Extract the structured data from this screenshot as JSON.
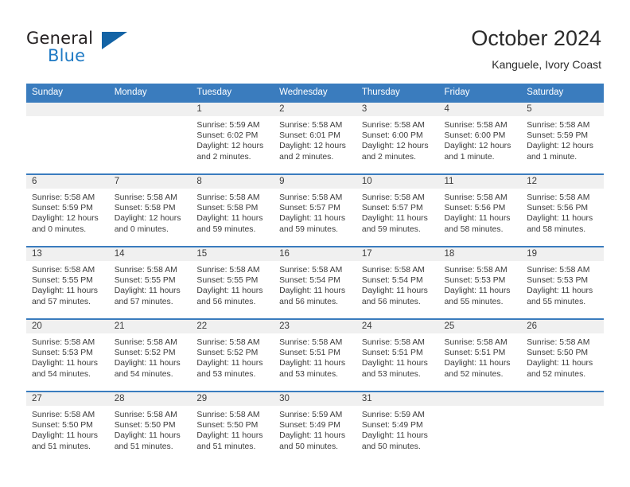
{
  "brand": {
    "name_part1": "General",
    "name_part2": "Blue",
    "accent_color": "#1f7ac4",
    "triangle_color": "#1363a5"
  },
  "header": {
    "title": "October 2024",
    "subtitle": "Kanguele, Ivory Coast"
  },
  "calendar": {
    "header_bg": "#3a7cbe",
    "daynum_bg": "#f0f0f0",
    "weekday_labels": [
      "Sunday",
      "Monday",
      "Tuesday",
      "Wednesday",
      "Thursday",
      "Friday",
      "Saturday"
    ],
    "labels": {
      "sunrise_prefix": "Sunrise:",
      "sunset_prefix": "Sunset:",
      "daylight_prefix": "Daylight:"
    },
    "weeks": [
      [
        {
          "day": "",
          "sunrise": "",
          "sunset": "",
          "daylight_line1": "",
          "daylight_line2": ""
        },
        {
          "day": "",
          "sunrise": "",
          "sunset": "",
          "daylight_line1": "",
          "daylight_line2": ""
        },
        {
          "day": "1",
          "sunrise": "Sunrise: 5:59 AM",
          "sunset": "Sunset: 6:02 PM",
          "daylight_line1": "Daylight: 12 hours",
          "daylight_line2": "and 2 minutes."
        },
        {
          "day": "2",
          "sunrise": "Sunrise: 5:58 AM",
          "sunset": "Sunset: 6:01 PM",
          "daylight_line1": "Daylight: 12 hours",
          "daylight_line2": "and 2 minutes."
        },
        {
          "day": "3",
          "sunrise": "Sunrise: 5:58 AM",
          "sunset": "Sunset: 6:00 PM",
          "daylight_line1": "Daylight: 12 hours",
          "daylight_line2": "and 2 minutes."
        },
        {
          "day": "4",
          "sunrise": "Sunrise: 5:58 AM",
          "sunset": "Sunset: 6:00 PM",
          "daylight_line1": "Daylight: 12 hours",
          "daylight_line2": "and 1 minute."
        },
        {
          "day": "5",
          "sunrise": "Sunrise: 5:58 AM",
          "sunset": "Sunset: 5:59 PM",
          "daylight_line1": "Daylight: 12 hours",
          "daylight_line2": "and 1 minute."
        }
      ],
      [
        {
          "day": "6",
          "sunrise": "Sunrise: 5:58 AM",
          "sunset": "Sunset: 5:59 PM",
          "daylight_line1": "Daylight: 12 hours",
          "daylight_line2": "and 0 minutes."
        },
        {
          "day": "7",
          "sunrise": "Sunrise: 5:58 AM",
          "sunset": "Sunset: 5:58 PM",
          "daylight_line1": "Daylight: 12 hours",
          "daylight_line2": "and 0 minutes."
        },
        {
          "day": "8",
          "sunrise": "Sunrise: 5:58 AM",
          "sunset": "Sunset: 5:58 PM",
          "daylight_line1": "Daylight: 11 hours",
          "daylight_line2": "and 59 minutes."
        },
        {
          "day": "9",
          "sunrise": "Sunrise: 5:58 AM",
          "sunset": "Sunset: 5:57 PM",
          "daylight_line1": "Daylight: 11 hours",
          "daylight_line2": "and 59 minutes."
        },
        {
          "day": "10",
          "sunrise": "Sunrise: 5:58 AM",
          "sunset": "Sunset: 5:57 PM",
          "daylight_line1": "Daylight: 11 hours",
          "daylight_line2": "and 59 minutes."
        },
        {
          "day": "11",
          "sunrise": "Sunrise: 5:58 AM",
          "sunset": "Sunset: 5:56 PM",
          "daylight_line1": "Daylight: 11 hours",
          "daylight_line2": "and 58 minutes."
        },
        {
          "day": "12",
          "sunrise": "Sunrise: 5:58 AM",
          "sunset": "Sunset: 5:56 PM",
          "daylight_line1": "Daylight: 11 hours",
          "daylight_line2": "and 58 minutes."
        }
      ],
      [
        {
          "day": "13",
          "sunrise": "Sunrise: 5:58 AM",
          "sunset": "Sunset: 5:55 PM",
          "daylight_line1": "Daylight: 11 hours",
          "daylight_line2": "and 57 minutes."
        },
        {
          "day": "14",
          "sunrise": "Sunrise: 5:58 AM",
          "sunset": "Sunset: 5:55 PM",
          "daylight_line1": "Daylight: 11 hours",
          "daylight_line2": "and 57 minutes."
        },
        {
          "day": "15",
          "sunrise": "Sunrise: 5:58 AM",
          "sunset": "Sunset: 5:55 PM",
          "daylight_line1": "Daylight: 11 hours",
          "daylight_line2": "and 56 minutes."
        },
        {
          "day": "16",
          "sunrise": "Sunrise: 5:58 AM",
          "sunset": "Sunset: 5:54 PM",
          "daylight_line1": "Daylight: 11 hours",
          "daylight_line2": "and 56 minutes."
        },
        {
          "day": "17",
          "sunrise": "Sunrise: 5:58 AM",
          "sunset": "Sunset: 5:54 PM",
          "daylight_line1": "Daylight: 11 hours",
          "daylight_line2": "and 56 minutes."
        },
        {
          "day": "18",
          "sunrise": "Sunrise: 5:58 AM",
          "sunset": "Sunset: 5:53 PM",
          "daylight_line1": "Daylight: 11 hours",
          "daylight_line2": "and 55 minutes."
        },
        {
          "day": "19",
          "sunrise": "Sunrise: 5:58 AM",
          "sunset": "Sunset: 5:53 PM",
          "daylight_line1": "Daylight: 11 hours",
          "daylight_line2": "and 55 minutes."
        }
      ],
      [
        {
          "day": "20",
          "sunrise": "Sunrise: 5:58 AM",
          "sunset": "Sunset: 5:53 PM",
          "daylight_line1": "Daylight: 11 hours",
          "daylight_line2": "and 54 minutes."
        },
        {
          "day": "21",
          "sunrise": "Sunrise: 5:58 AM",
          "sunset": "Sunset: 5:52 PM",
          "daylight_line1": "Daylight: 11 hours",
          "daylight_line2": "and 54 minutes."
        },
        {
          "day": "22",
          "sunrise": "Sunrise: 5:58 AM",
          "sunset": "Sunset: 5:52 PM",
          "daylight_line1": "Daylight: 11 hours",
          "daylight_line2": "and 53 minutes."
        },
        {
          "day": "23",
          "sunrise": "Sunrise: 5:58 AM",
          "sunset": "Sunset: 5:51 PM",
          "daylight_line1": "Daylight: 11 hours",
          "daylight_line2": "and 53 minutes."
        },
        {
          "day": "24",
          "sunrise": "Sunrise: 5:58 AM",
          "sunset": "Sunset: 5:51 PM",
          "daylight_line1": "Daylight: 11 hours",
          "daylight_line2": "and 53 minutes."
        },
        {
          "day": "25",
          "sunrise": "Sunrise: 5:58 AM",
          "sunset": "Sunset: 5:51 PM",
          "daylight_line1": "Daylight: 11 hours",
          "daylight_line2": "and 52 minutes."
        },
        {
          "day": "26",
          "sunrise": "Sunrise: 5:58 AM",
          "sunset": "Sunset: 5:50 PM",
          "daylight_line1": "Daylight: 11 hours",
          "daylight_line2": "and 52 minutes."
        }
      ],
      [
        {
          "day": "27",
          "sunrise": "Sunrise: 5:58 AM",
          "sunset": "Sunset: 5:50 PM",
          "daylight_line1": "Daylight: 11 hours",
          "daylight_line2": "and 51 minutes."
        },
        {
          "day": "28",
          "sunrise": "Sunrise: 5:58 AM",
          "sunset": "Sunset: 5:50 PM",
          "daylight_line1": "Daylight: 11 hours",
          "daylight_line2": "and 51 minutes."
        },
        {
          "day": "29",
          "sunrise": "Sunrise: 5:58 AM",
          "sunset": "Sunset: 5:50 PM",
          "daylight_line1": "Daylight: 11 hours",
          "daylight_line2": "and 51 minutes."
        },
        {
          "day": "30",
          "sunrise": "Sunrise: 5:59 AM",
          "sunset": "Sunset: 5:49 PM",
          "daylight_line1": "Daylight: 11 hours",
          "daylight_line2": "and 50 minutes."
        },
        {
          "day": "31",
          "sunrise": "Sunrise: 5:59 AM",
          "sunset": "Sunset: 5:49 PM",
          "daylight_line1": "Daylight: 11 hours",
          "daylight_line2": "and 50 minutes."
        },
        {
          "day": "",
          "sunrise": "",
          "sunset": "",
          "daylight_line1": "",
          "daylight_line2": ""
        },
        {
          "day": "",
          "sunrise": "",
          "sunset": "",
          "daylight_line1": "",
          "daylight_line2": ""
        }
      ]
    ]
  }
}
